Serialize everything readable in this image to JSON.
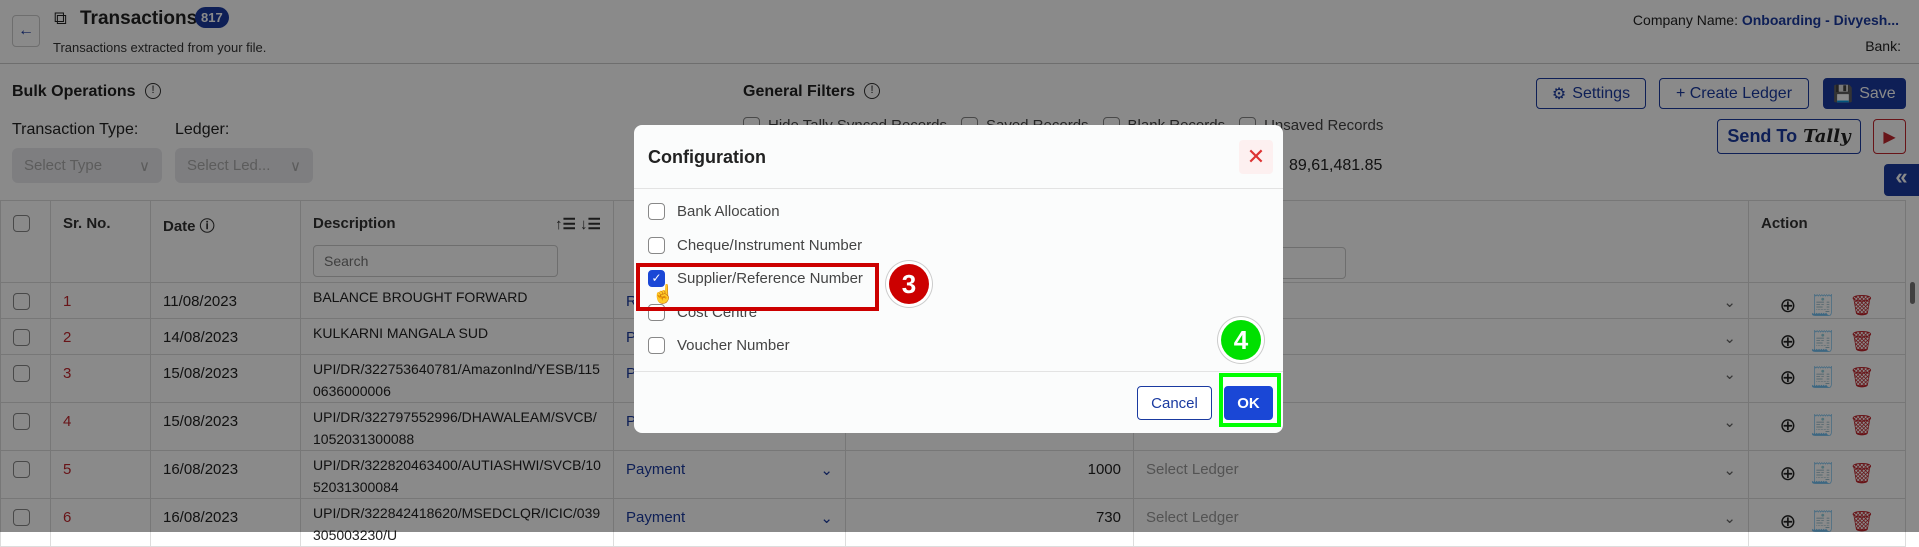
{
  "header": {
    "title": "Transactions",
    "count": "817",
    "subtitle": "Transactions extracted from your file.",
    "company_label": "Company Name:",
    "company_value": "Onboarding - Divyesh...",
    "bank_label": "Bank:"
  },
  "bulk": {
    "title": "Bulk Operations",
    "type_label": "Transaction Type:",
    "ledger_label": "Ledger:",
    "type_placeholder": "Select Type",
    "ledger_placeholder": "Select Led..."
  },
  "filters": {
    "title": "General Filters",
    "options": [
      "Hide Tally Synced Records",
      "Saved Records",
      "Blank Records",
      "Unsaved Records"
    ],
    "amount": "89,61,481.85"
  },
  "toolbar": {
    "settings": "Settings",
    "create_ledger": "+ Create Ledger",
    "save": "Save",
    "send_to": "Send To",
    "tally": "Tally"
  },
  "table": {
    "headers": {
      "srno": "Sr. No.",
      "date": "Date",
      "description": "Description",
      "action": "Action"
    },
    "search_placeholder": "Search",
    "rows": [
      {
        "sr": "1",
        "date": "11/08/2023",
        "desc": "BALANCE BROUGHT FORWARD",
        "type": "Receipt",
        "amount": "",
        "ledger": ""
      },
      {
        "sr": "2",
        "date": "14/08/2023",
        "desc": "KULKARNI MANGALA SUD",
        "type": "Payment",
        "amount": "",
        "ledger": ""
      },
      {
        "sr": "3",
        "date": "15/08/2023",
        "desc": "UPI/DR/322753640781/AmazonInd/YESB/1150636000006",
        "type": "Payment",
        "amount": "",
        "ledger": ""
      },
      {
        "sr": "4",
        "date": "15/08/2023",
        "desc": "UPI/DR/322797552996/DHAWALEAM/SVCB/1052031300088",
        "type": "Payment",
        "amount": "",
        "ledger": ""
      },
      {
        "sr": "5",
        "date": "16/08/2023",
        "desc": "UPI/DR/322820463400/AUTIASHWI/SVCB/1052031300084",
        "type": "Payment",
        "amount": "1000",
        "ledger": "Select Ledger"
      },
      {
        "sr": "6",
        "date": "16/08/2023",
        "desc": "UPI/DR/322842418620/MSEDCLQR/ICIC/039305003230/U",
        "type": "Payment",
        "amount": "730",
        "ledger": "Select Ledger"
      }
    ]
  },
  "modal": {
    "title": "Configuration",
    "options": [
      {
        "label": "Bank Allocation",
        "checked": false
      },
      {
        "label": "Cheque/Instrument Number",
        "checked": false
      },
      {
        "label": "Supplier/Reference Number",
        "checked": true
      },
      {
        "label": "Cost Centre",
        "checked": false
      },
      {
        "label": "Voucher Number",
        "checked": false
      }
    ],
    "cancel": "Cancel",
    "ok": "OK"
  },
  "annotations": {
    "step3": "3",
    "step4": "4"
  },
  "colors": {
    "brand": "#1a3aa0",
    "danger": "#c0262d",
    "highlight_red": "#cc0000",
    "highlight_green": "#00ff00"
  }
}
